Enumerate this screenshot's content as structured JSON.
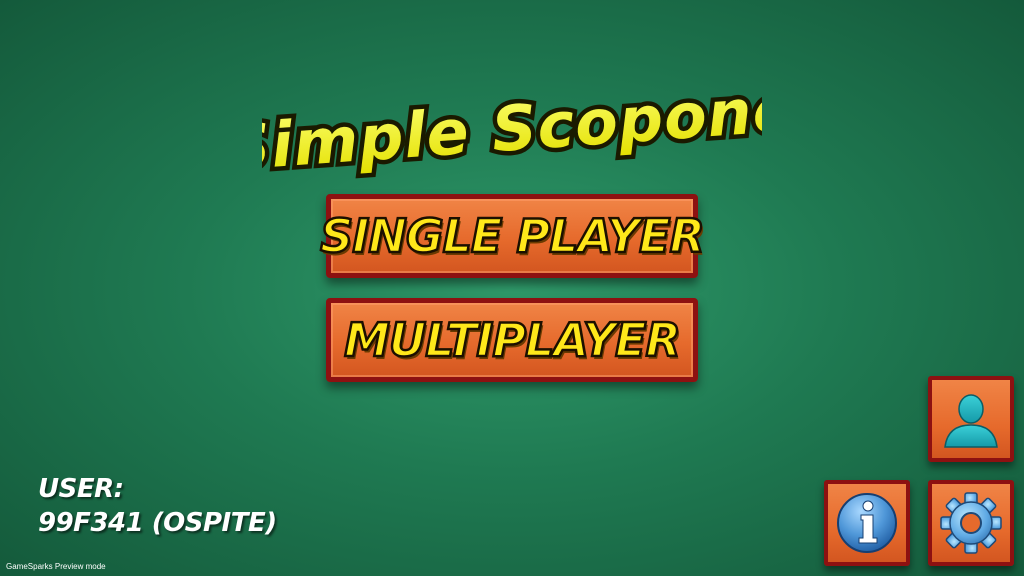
{
  "game": {
    "title": "Simple Scopone"
  },
  "menu": {
    "single_player_label": "SINGLE PLAYER",
    "multiplayer_label": "MULTIPLAYER"
  },
  "user": {
    "label": "USER:",
    "name": "99F341 (OSPITE)"
  },
  "footer": {
    "preview_text": "GameSparks Preview mode"
  },
  "icons": {
    "profile": "user-silhouette-icon",
    "info": "info-icon",
    "settings": "gear-icon"
  },
  "colors": {
    "background": "#1f7a52",
    "button_fill": "#e66a2c",
    "button_border": "#8d1111",
    "button_text": "#ffe81a",
    "title_text": "#f2f21a"
  }
}
